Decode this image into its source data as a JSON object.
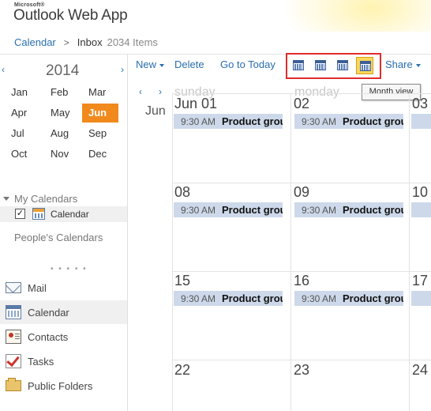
{
  "app": {
    "vendor": "Microsoft®",
    "title": "Outlook Web App"
  },
  "breadcrumb": {
    "parent": "Calendar",
    "current": "Inbox",
    "count": "2034 Items"
  },
  "toolbar": {
    "new_label": "New",
    "delete_label": "Delete",
    "today_label": "Go to Today",
    "share_label": "Share",
    "view_buttons": [
      "day-view-icon",
      "work-week-view-icon",
      "week-view-icon",
      "month-view-icon"
    ],
    "selected_view": "Month view",
    "tooltip": "Month view"
  },
  "mini_calendar": {
    "year": "2014",
    "months": [
      "Jan",
      "Feb",
      "Mar",
      "Apr",
      "May",
      "Jun",
      "Jul",
      "Aug",
      "Sep",
      "Oct",
      "Nov",
      "Dec"
    ],
    "selected": "Jun"
  },
  "my_calendars": {
    "heading": "My Calendars",
    "items": [
      {
        "label": "Calendar",
        "checked": true
      }
    ]
  },
  "peoples_calendars": "People's Calendars",
  "nav": {
    "dots": "• • • • •",
    "items": [
      {
        "label": "Mail",
        "icon": "mail-icon"
      },
      {
        "label": "Calendar",
        "icon": "calendar-icon",
        "active": true
      },
      {
        "label": "Contacts",
        "icon": "contacts-icon"
      },
      {
        "label": "Tasks",
        "icon": "tasks-icon"
      },
      {
        "label": "Public Folders",
        "icon": "public-folders-icon"
      }
    ]
  },
  "calendar": {
    "month_label": "Jun",
    "day_names": [
      "sunday",
      "monday"
    ],
    "weeks": [
      {
        "days": [
          "Jun 01",
          "02",
          "03"
        ],
        "events": [
          "Product grou",
          "Product grou"
        ]
      },
      {
        "days": [
          "08",
          "09",
          "10"
        ],
        "events": [
          "Product grou",
          "Product grou"
        ]
      },
      {
        "days": [
          "15",
          "16",
          "17"
        ],
        "events": [
          "Product grou",
          "Product grou"
        ]
      },
      {
        "days": [
          "22",
          "23",
          "24"
        ],
        "events": []
      }
    ],
    "event_time": "9:30 AM"
  },
  "colors": {
    "accent": "#2a6fb0",
    "selected_month": "#f18a1d",
    "event_bg": "#cdd9ea",
    "highlight_box": "#e02b2b",
    "selected_view_bg": "#fbd75b"
  }
}
